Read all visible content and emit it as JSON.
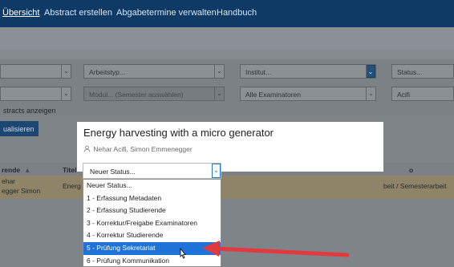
{
  "nav": {
    "items": [
      {
        "label": "Übersicht",
        "active": true
      },
      {
        "label": "Abstract erstellen",
        "active": false
      },
      {
        "label": "Abgabetermine verwalten",
        "active": false
      },
      {
        "label": "Handbuch",
        "active": false
      }
    ]
  },
  "filters": {
    "arbeitstyp_placeholder": "Arbeitstyp...",
    "institut_placeholder": "Institut...",
    "status_placeholder": "Status...",
    "modul_placeholder": "Modul... (Semester auswählen)",
    "examinatoren_value": "Alle Examinatoren",
    "person_value": "Acifi",
    "abstracts_label": "stracts anzeigen",
    "aktualisieren_label": "ualisieren"
  },
  "table": {
    "headers": {
      "studierende": "rende",
      "sort_glyph": "▲",
      "titel": "Titel",
      "extra": "o"
    },
    "row": {
      "name_line1": "ehar",
      "name_line2": "egger Simon",
      "title_fragment": "Energ",
      "type_fragment": "beit / Semesterarbeit"
    }
  },
  "modal": {
    "title": "Energy harvesting with a micro generator",
    "authors": "Nehar Acifi, Simon Emmenegger",
    "status_select": {
      "current_value": "Neuer Status...",
      "options": [
        "Neuer Status...",
        "1 - Erfassung Metadaten",
        "2 - Erfassung Studierende",
        "3 - Korrektur/Freigabe Examinatoren",
        "4 - Korrektur Studierende",
        "5 - Prüfung Sekretariat",
        "6 - Prüfung Kommunikation"
      ],
      "highlighted_index": 5
    }
  },
  "colors": {
    "nav_bg": "#0f3a66",
    "highlight": "#1f72d8",
    "annotation_arrow": "#e03a3e"
  }
}
